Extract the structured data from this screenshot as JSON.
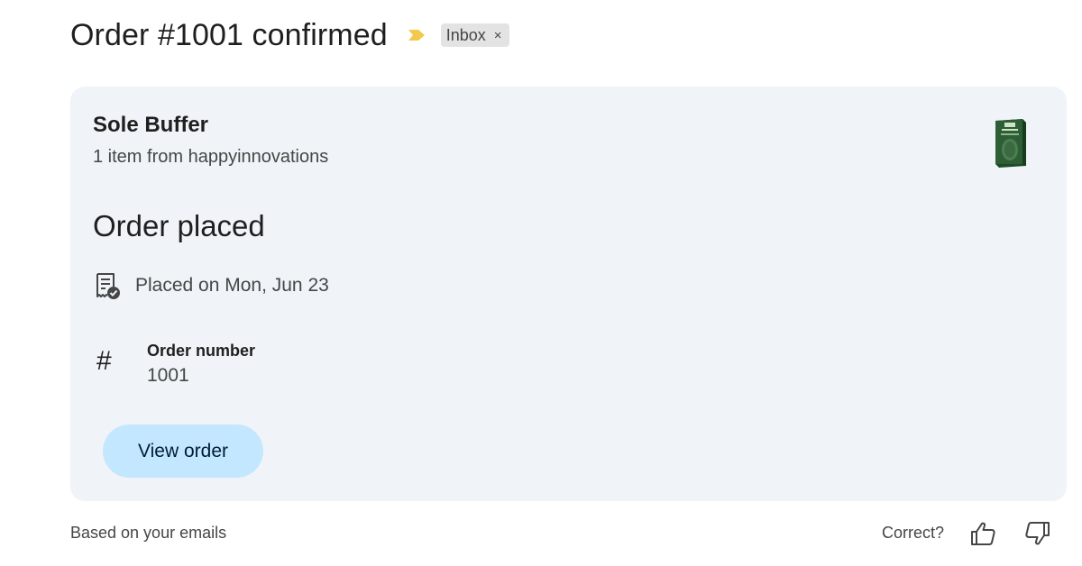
{
  "header": {
    "subject": "Order #1001 confirmed",
    "importance_icon": "importance-marker-icon",
    "label_chip": {
      "label": "Inbox",
      "close_glyph": "×"
    }
  },
  "card": {
    "product_name": "Sole Buffer",
    "item_summary": "1 item from happyinnovations",
    "product_image_icon": "product-box-thumbnail",
    "status_heading": "Order placed",
    "placed_icon": "receipt-check-icon",
    "placed_text": "Placed on Mon, Jun 23",
    "order_number_icon": "#",
    "order_number_label": "Order number",
    "order_number_value": "1001",
    "view_order_label": "View order"
  },
  "footer": {
    "note": "Based on your emails",
    "feedback_prompt": "Correct?",
    "thumbs_up_icon": "thumbs-up-icon",
    "thumbs_down_icon": "thumbs-down-icon"
  },
  "colors": {
    "card_background": "#f0f4f9",
    "button_background": "#c2e7ff",
    "importance_marker": "#f2c94c",
    "chip_background": "#e3e3e3",
    "product_box": "#2e5e35"
  }
}
